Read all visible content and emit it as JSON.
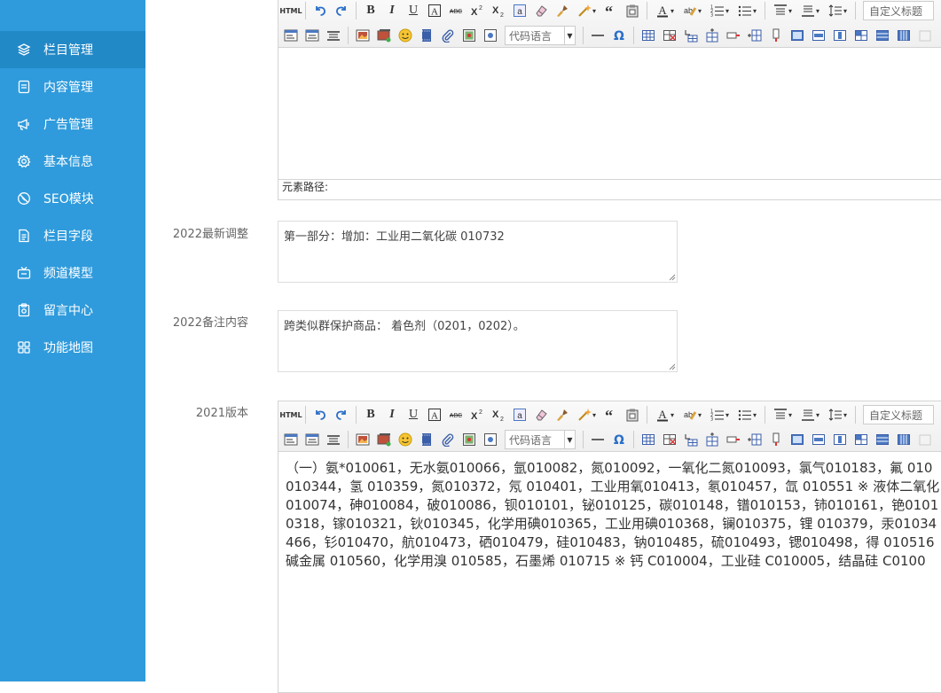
{
  "sidebar": {
    "items": [
      {
        "label": "栏目管理",
        "icon": "layers-icon"
      },
      {
        "label": "内容管理",
        "icon": "document-icon"
      },
      {
        "label": "广告管理",
        "icon": "megaphone-icon"
      },
      {
        "label": "基本信息",
        "icon": "gear-icon"
      },
      {
        "label": "SEO模块",
        "icon": "no-entry-icon"
      },
      {
        "label": "栏目字段",
        "icon": "file-list-icon"
      },
      {
        "label": "频道模型",
        "icon": "tv-icon"
      },
      {
        "label": "留言中心",
        "icon": "clipboard-icon"
      },
      {
        "label": "功能地图",
        "icon": "grid-icon"
      }
    ]
  },
  "editor": {
    "code_language_placeholder": "代码语言",
    "custom_title": "自定义标题",
    "element_path_label": "元素路径:"
  },
  "fields": {
    "adjust_label": "2022最新调整",
    "adjust_value": "第一部分：增加：工业用二氧化碳 010732",
    "remark_label": "2022备注内容",
    "remark_value": "跨类似群保护商品： 着色剂（0201，0202）。",
    "version_label": "2021版本",
    "version_lines": [
      "（一）氨*010061，无水氨010066，氩010082，氮010092，一氧化二氮010093，氯气010183，氟 010",
      "010344，氢 010359，氮010372，氖 010401，工业用氧010413，氡010457，氙 010551 ※ 液体二氧化",
      "010074，砷010084，破010086，钡010101，铋010125，碳010148，镨010153，铈010161，铯0101",
      "0318，镓010321，钬010345，化学用碘010365，工业用碘010368，镧010375，锂 010379，汞01034",
      "466，钐010470，航010473，硒010479，硅010483，钠010485，硫010493，锶010498，得 010516",
      "碱金属 010560，化学用溴 010585，石墨烯 010715 ※ 钙 C010004，工业硅 C010005，结晶硅 C0100"
    ]
  }
}
